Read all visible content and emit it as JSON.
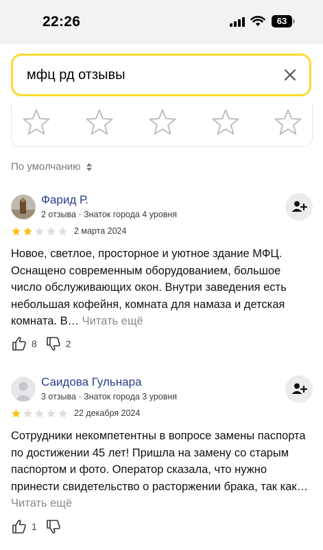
{
  "status_bar": {
    "time": "22:26",
    "battery": "63"
  },
  "search": {
    "query": "мфц рд отзывы"
  },
  "rating_prompt": {
    "stars": 5
  },
  "sort": {
    "label": "По умолчанию"
  },
  "reviews": [
    {
      "author": "Фарид Р.",
      "meta": "2 отзыва · Знаток города 4 уровня",
      "rating": 2,
      "date": "2 марта 2024",
      "text": "Новое, светлое, просторное и уютное здание МФЦ. Оснащено современным оборудованием, большое число обслуживающих окон. Внутри заведения есть небольшая кофейня, комната для намаза и детская комната. В…",
      "read_more": "Читать ещё",
      "likes": "8",
      "dislikes": "2"
    },
    {
      "author": "Саидова Гульнара",
      "meta": "3 отзыва · Знаток города 3 уровня",
      "rating": 1,
      "date": "22 декабря 2024",
      "text": "Сотрудники некомпетентны в вопросе замены паспорта по достижении 45 лет! Пришла на замену со старым паспортом и фото. Оператор сказала, что нужно принести свидетельство о расторжении брака, так как…",
      "read_more": "Читать ещё",
      "likes": "1",
      "dislikes": ""
    }
  ],
  "colors": {
    "accent": "#fcd92e",
    "star_filled": "#f7c21d",
    "star_empty": "#dedede",
    "author": "#2a3c8c"
  }
}
